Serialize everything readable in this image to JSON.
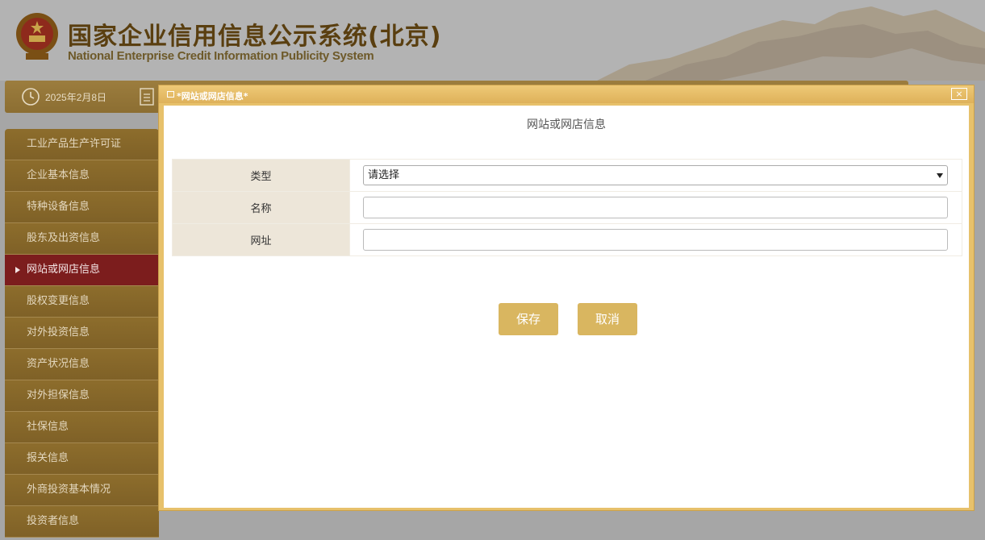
{
  "header": {
    "title_cn": "国家企业信用信息公示系统(北京)",
    "title_en": "National Enterprise Credit Information Publicity System"
  },
  "infobar": {
    "date": "2025年2月8日"
  },
  "sidebar": {
    "items": [
      {
        "label": "工业产品生产许可证"
      },
      {
        "label": "企业基本信息"
      },
      {
        "label": "特种设备信息"
      },
      {
        "label": "股东及出资信息"
      },
      {
        "label": "网站或网店信息"
      },
      {
        "label": "股权变更信息"
      },
      {
        "label": "对外投资信息"
      },
      {
        "label": "资产状况信息"
      },
      {
        "label": "对外担保信息"
      },
      {
        "label": "社保信息"
      },
      {
        "label": "报关信息"
      },
      {
        "label": "外商投资基本情况"
      },
      {
        "label": "投资者信息"
      }
    ],
    "active_index": 4
  },
  "modal": {
    "title": "*网站或网店信息*",
    "close_label": "×",
    "heading": "网站或网店信息",
    "fields": {
      "type_label": "类型",
      "type_value": "请选择",
      "name_label": "名称",
      "name_value": "",
      "url_label": "网址",
      "url_value": ""
    },
    "save_label": "保存",
    "cancel_label": "取消"
  },
  "colors": {
    "sidebar_bg": "#8d6d2c",
    "sidebar_active": "#7c1d1d",
    "modal_frame": "#e7c16b",
    "button_bg": "#d9b660",
    "label_cell_bg": "#ede6d9"
  }
}
